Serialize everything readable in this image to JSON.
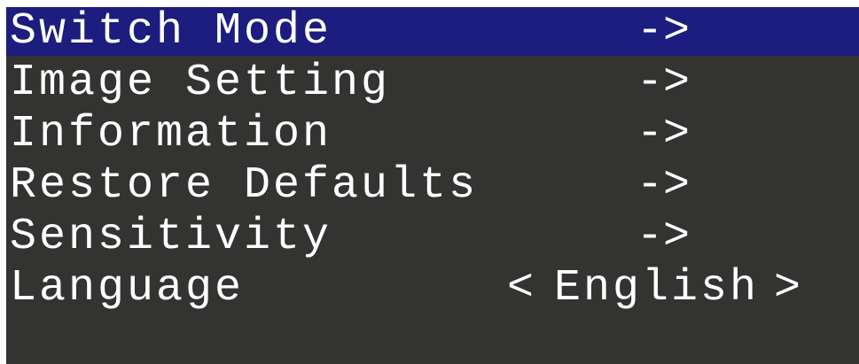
{
  "menu": {
    "items": [
      {
        "label": "Switch Mode",
        "value": "->",
        "selected": true
      },
      {
        "label": "Image Setting",
        "value": "->",
        "selected": false
      },
      {
        "label": "Information",
        "value": "->",
        "selected": false
      },
      {
        "label": "Restore Defaults",
        "value": "->",
        "selected": false
      },
      {
        "label": "Sensitivity",
        "value": "->",
        "selected": false
      }
    ],
    "language": {
      "label": "Language",
      "prev": "<",
      "value": "English",
      "next": ">"
    }
  },
  "colors": {
    "background": "#333331",
    "selected_row": "#1c1d7e",
    "text": "#ffffff"
  }
}
